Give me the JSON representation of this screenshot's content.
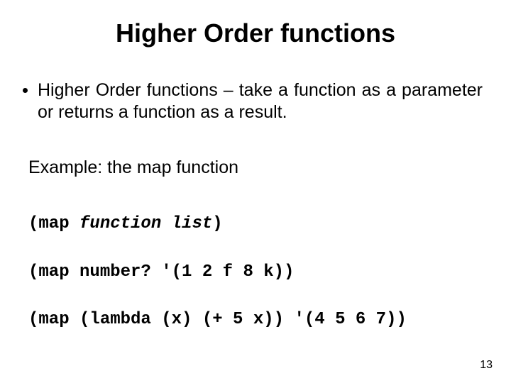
{
  "title": "Higher Order functions",
  "bullet1": "Higher Order functions – take a function as a parameter or returns a function as a result.",
  "example_label": "Example: the map function",
  "code": {
    "l1_open": "(map ",
    "l1_ital": "function list",
    "l1_close": ")",
    "l2": "(map number? '(1 2 f 8 k))",
    "l3": "(map (lambda (x) (+ 5 x)) '(4 5 6 7))"
  },
  "page_number": "13"
}
